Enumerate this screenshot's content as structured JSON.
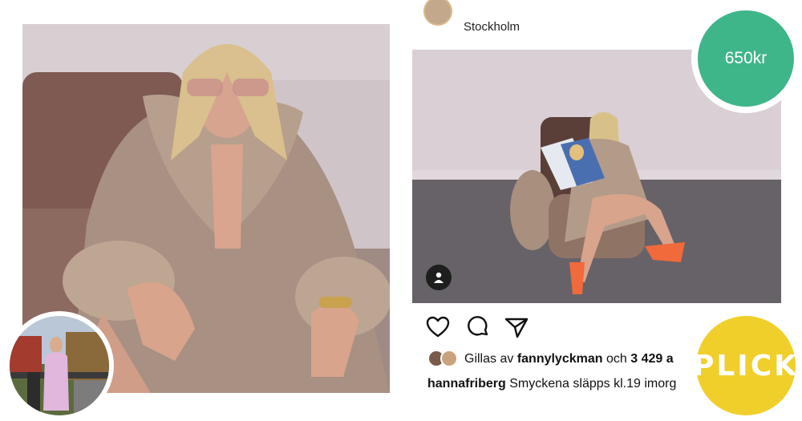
{
  "post": {
    "location": "Stockholm",
    "liked_by_prefix": "Gillas av",
    "liked_by_user": "fannylyckman",
    "liked_by_conj": "och",
    "liked_by_count": "3 429 a",
    "caption_user": "hannafriberg",
    "caption_text": "Smyckena släpps kl.19 imorg"
  },
  "badges": {
    "price": "650kr",
    "brand": "PLICK"
  },
  "colors": {
    "price_green": "#3fb58a",
    "plick_yellow": "#f1cf2b"
  },
  "icons": [
    "heart-icon",
    "comment-icon",
    "share-icon",
    "user-tag-icon"
  ]
}
